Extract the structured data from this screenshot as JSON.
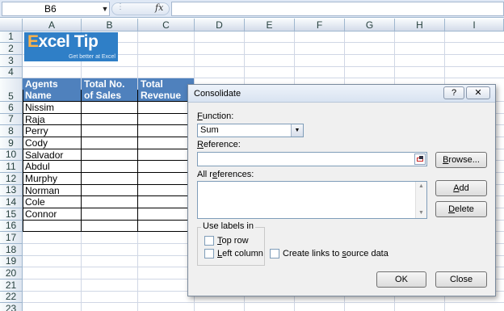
{
  "formula_bar": {
    "name_box": "B6",
    "name_box_arrow": "▼",
    "dots": "⋮",
    "fx": "fx",
    "formula_value": ""
  },
  "grid": {
    "columns": [
      "A",
      "B",
      "C",
      "D",
      "E",
      "F",
      "G",
      "H",
      "I"
    ],
    "rows": [
      "1",
      "2",
      "3",
      "4",
      "5",
      "6",
      "7",
      "8",
      "9",
      "10",
      "11",
      "12",
      "13",
      "14",
      "15",
      "16",
      "17",
      "18",
      "19",
      "20",
      "21",
      "22",
      "23"
    ]
  },
  "logo": {
    "title_x": "E",
    "title_rest": "xcel Tip",
    "tagline": "Get better at Excel"
  },
  "table": {
    "headers": [
      [
        "Agents",
        "Name"
      ],
      [
        "Total No.",
        "of Sales"
      ],
      [
        "Total",
        "Revenue"
      ]
    ],
    "names": [
      "Nissim",
      "Raja",
      "Perry",
      "Cody",
      "Salvador",
      "Abdul",
      "Murphy",
      "Norman",
      "Cole",
      "Connor"
    ]
  },
  "dialog": {
    "title": "Consolidate",
    "help_glyph": "?",
    "close_glyph": "✕",
    "function_label_u": "F",
    "function_label_rest": "unction:",
    "function_value": "Sum",
    "select_arrow": "▼",
    "reference_label_u": "R",
    "reference_label_rest": "eference:",
    "reference_value": "",
    "allrefs_label_pre": "All r",
    "allrefs_label_u": "e",
    "allrefs_label_post": "ferences:",
    "scroll_up": "▲",
    "scroll_down": "▼",
    "browse_label_u": "B",
    "browse_label_rest": "rowse...",
    "add_label_u": "A",
    "add_label_rest": "dd",
    "delete_label_u": "D",
    "delete_label_rest": "elete",
    "labels_group": "Use labels in",
    "top_row_u": "T",
    "top_row_rest": "op row",
    "left_column_u": "L",
    "left_column_rest": "eft column",
    "links_pre": "Create links to ",
    "links_u": "s",
    "links_post": "ource data",
    "ok_label": "OK",
    "close_label": "Close"
  }
}
